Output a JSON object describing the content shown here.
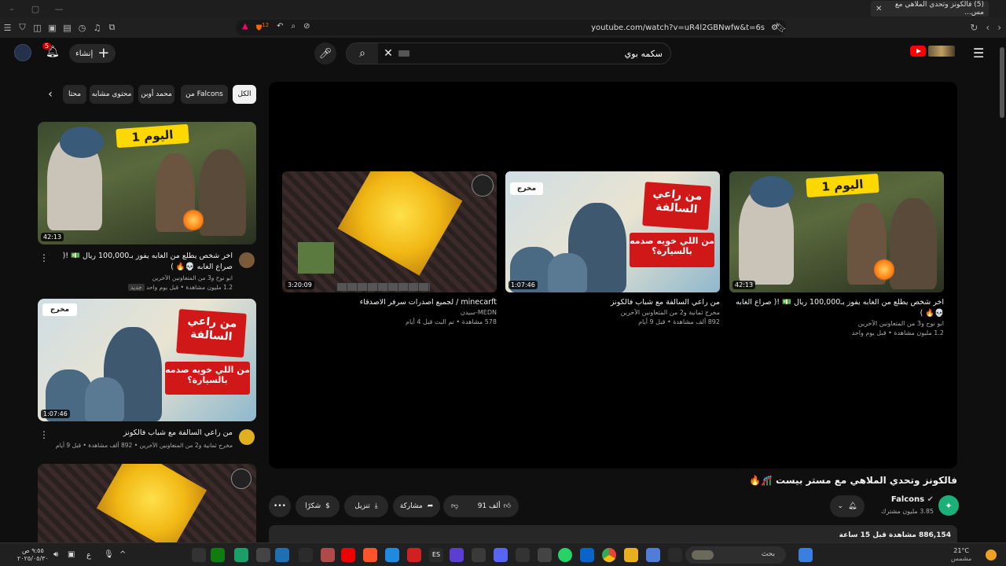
{
  "browser": {
    "tab_title": "(5) فالكونز وتحدي الملاهي مع مس...",
    "url": "youtube.com/watch?v=uR4l2GBNwfw&t=6s",
    "shield_count": "12"
  },
  "header": {
    "create_label": "إنشاء",
    "notif_count": "5",
    "search_value": "سكمه بوي"
  },
  "chips": [
    "الكل",
    "من Falcons",
    "محمد أوبن",
    "محتوى مشابه",
    "محتا"
  ],
  "sidebar": [
    {
      "title": "اخر شخص يطلع من الغابه يفوز بـ100,000 ريال 💵 !( صراع الغابه 💀🔥 )",
      "channel": "ابو نوح و3 من المتعاونين الآخرين",
      "meta": "1.2 مليون مشاهدة • قبل يوم واحد",
      "badge": "جديد",
      "duration": "42:13",
      "art_text": "اليوم 1"
    },
    {
      "title": "من راعي السالفة مع شباب فالكونز",
      "channel": "",
      "meta": "مخرج ثمانية و2 من المتعاونين الآخرين • 892 ألف مشاهدة • قبل 9 أيام",
      "badge": "",
      "duration": "1:07:46",
      "art_text": "من راعي السالفة",
      "art_sub": "من اللي خويه صدمه بالسيارة؟",
      "art_tag": "مخرج"
    }
  ],
  "player_cards": [
    {
      "title": "minecarft / لجميع اصدرات سرفر الاصدقاء",
      "channel": "MEDN-سيدن",
      "meta": "578 مشاهدة • تم البث قبل 4 أيام",
      "duration": "3:20:09"
    },
    {
      "title": "من راعي السالفة مع شباب فالكونز",
      "channel": "مخرج ثمانية و2 من المتعاونين الآخرين",
      "meta": "892 ألف مشاهدة • قبل 9 أيام",
      "duration": "1:07:46",
      "art_text": "من راعي السالفة",
      "art_sub": "من اللي خويه صدمه بالسيارة؟",
      "art_tag": "مخرج"
    },
    {
      "title": "اخر شخص يطلع من الغابه يفوز بـ100,000 ريال 💵 !( صراع الغابه 💀🔥 )",
      "channel": "ابو نوح و3 من المتعاونين الآخرين",
      "meta": "1.2 مليون مشاهدة • قبل يوم واحد",
      "duration": "42:13",
      "art_text": "اليوم 1"
    }
  ],
  "video": {
    "title": "فالكونز وتحدي الملاهي مع مستر بيست 🎢🔥",
    "channel": "Falcons",
    "subs": "3.85 مليون مشترك",
    "likes": "91 ألف",
    "share": "مشاركة",
    "download": "تنزيل",
    "thanks": "شكرًا",
    "desc_meta": "886,154 مشاهدة قبل 15 ساعة"
  },
  "taskbar": {
    "search_label": "بحث",
    "weather_temp": "21°C",
    "weather_text": "مشمس",
    "time": "٩:٥٥ ص",
    "date": "٢٠٢٥/٠٥/٣٠",
    "lang": "ع"
  },
  "colors": {
    "bg": "#0f0f0f",
    "accent": "#ff0000",
    "chip": "#272727"
  }
}
